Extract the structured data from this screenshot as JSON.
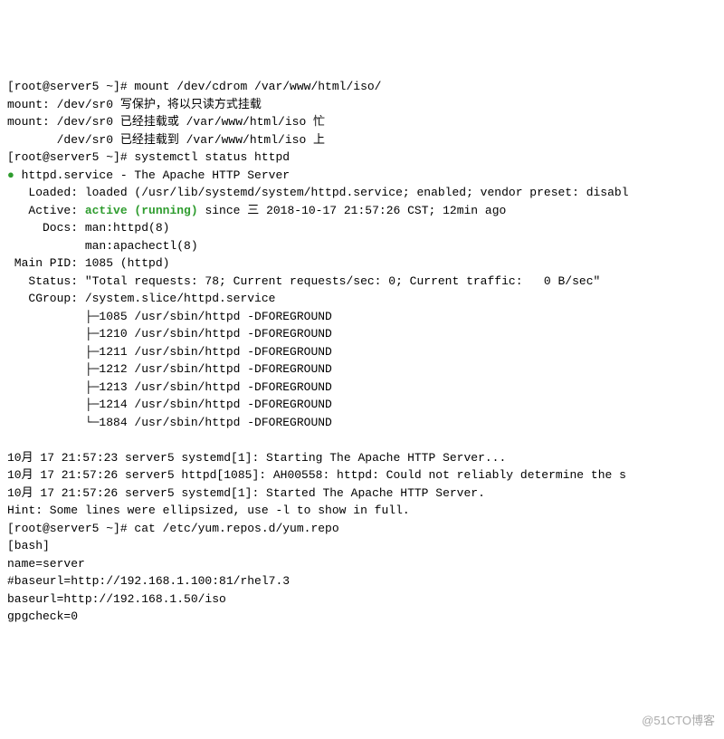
{
  "lines": [
    {
      "segs": [
        {
          "t": "[root@server5 ~]# mount /dev/cdrom /var/www/html/iso/"
        }
      ]
    },
    {
      "segs": [
        {
          "t": "mount: /dev/sr0 写保护，将以只读方式挂载"
        }
      ]
    },
    {
      "segs": [
        {
          "t": "mount: /dev/sr0 已经挂载或 /var/www/html/iso 忙"
        }
      ]
    },
    {
      "segs": [
        {
          "t": "       /dev/sr0 已经挂载到 /var/www/html/iso 上"
        }
      ]
    },
    {
      "segs": [
        {
          "t": "[root@server5 ~]# systemctl status httpd"
        }
      ]
    },
    {
      "segs": [
        {
          "t": "● ",
          "cls": "bullet"
        },
        {
          "t": "httpd.service - The Apache HTTP Server"
        }
      ]
    },
    {
      "segs": [
        {
          "t": "   Loaded: loaded (/usr/lib/systemd/system/httpd.service; enabled; vendor preset: disabl"
        }
      ]
    },
    {
      "segs": [
        {
          "t": "   Active: "
        },
        {
          "t": "active (running)",
          "cls": "green"
        },
        {
          "t": " since 三 2018-10-17 21:57:26 CST; 12min ago"
        }
      ]
    },
    {
      "segs": [
        {
          "t": "     Docs: man:httpd(8)"
        }
      ]
    },
    {
      "segs": [
        {
          "t": "           man:apachectl(8)"
        }
      ]
    },
    {
      "segs": [
        {
          "t": " Main PID: 1085 (httpd)"
        }
      ]
    },
    {
      "segs": [
        {
          "t": "   Status: \"Total requests: 78; Current requests/sec: 0; Current traffic:   0 B/sec\""
        }
      ]
    },
    {
      "segs": [
        {
          "t": "   CGroup: /system.slice/httpd.service"
        }
      ]
    },
    {
      "segs": [
        {
          "t": "           ├─1085 /usr/sbin/httpd -DFOREGROUND"
        }
      ]
    },
    {
      "segs": [
        {
          "t": "           ├─1210 /usr/sbin/httpd -DFOREGROUND"
        }
      ]
    },
    {
      "segs": [
        {
          "t": "           ├─1211 /usr/sbin/httpd -DFOREGROUND"
        }
      ]
    },
    {
      "segs": [
        {
          "t": "           ├─1212 /usr/sbin/httpd -DFOREGROUND"
        }
      ]
    },
    {
      "segs": [
        {
          "t": "           ├─1213 /usr/sbin/httpd -DFOREGROUND"
        }
      ]
    },
    {
      "segs": [
        {
          "t": "           ├─1214 /usr/sbin/httpd -DFOREGROUND"
        }
      ]
    },
    {
      "segs": [
        {
          "t": "           └─1884 /usr/sbin/httpd -DFOREGROUND"
        }
      ]
    },
    {
      "segs": [
        {
          "t": ""
        }
      ]
    },
    {
      "segs": [
        {
          "t": "10月 17 21:57:23 server5 systemd[1]: Starting The Apache HTTP Server..."
        }
      ]
    },
    {
      "segs": [
        {
          "t": "10月 17 21:57:26 server5 httpd[1085]: AH00558: httpd: Could not reliably determine the s"
        }
      ]
    },
    {
      "segs": [
        {
          "t": "10月 17 21:57:26 server5 systemd[1]: Started The Apache HTTP Server."
        }
      ]
    },
    {
      "segs": [
        {
          "t": "Hint: Some lines were ellipsized, use -l to show in full."
        }
      ]
    },
    {
      "segs": [
        {
          "t": "[root@server5 ~]# cat /etc/yum.repos.d/yum.repo"
        }
      ]
    },
    {
      "segs": [
        {
          "t": "[bash]"
        }
      ]
    },
    {
      "segs": [
        {
          "t": "name=server"
        }
      ]
    },
    {
      "segs": [
        {
          "t": "#baseurl=http://192.168.1.100:81/rhel7.3"
        }
      ]
    },
    {
      "segs": [
        {
          "t": "baseurl=http://192.168.1.50/iso"
        }
      ]
    },
    {
      "segs": [
        {
          "t": "gpgcheck=0"
        }
      ]
    }
  ],
  "watermark": "@51CTO博客"
}
